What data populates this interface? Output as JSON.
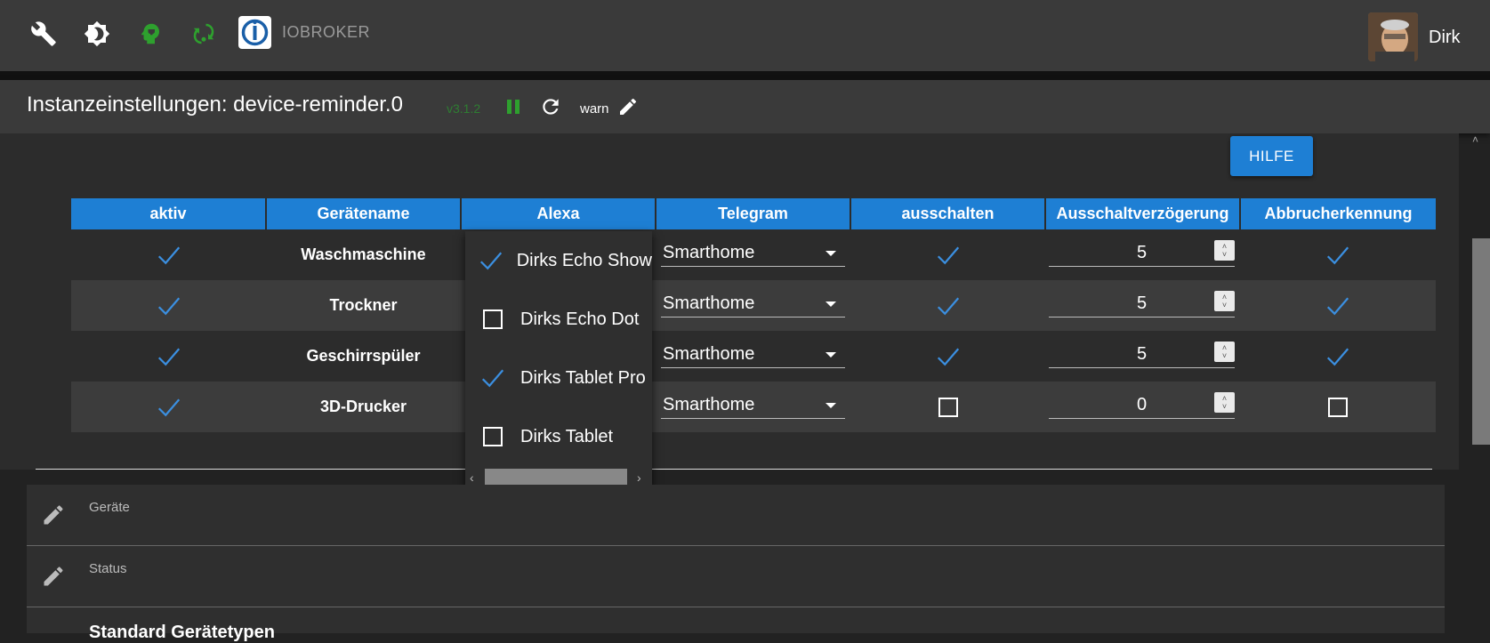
{
  "topbar": {
    "brand": "IOBROKER",
    "user": "Dirk",
    "icons": [
      "wrench-icon",
      "theme-icon",
      "expert-mode-icon",
      "update-icon"
    ]
  },
  "header": {
    "title": "Instanzeinstellungen: device-reminder.0",
    "version": "v3.1.2",
    "log_level": "warn"
  },
  "help_button": "HILFE",
  "table": {
    "columns": [
      "aktiv",
      "Gerätename",
      "Alexa",
      "Telegram",
      "ausschalten",
      "Ausschaltverzögerung",
      "Abbrucherkennung"
    ],
    "rows": [
      {
        "aktiv": true,
        "name": "Waschmaschine",
        "telegram": "Smarthome",
        "ausschalten": true,
        "delay": "5",
        "abbruch": true
      },
      {
        "aktiv": true,
        "name": "Trockner",
        "telegram": "Smarthome",
        "ausschalten": true,
        "delay": "5",
        "abbruch": true
      },
      {
        "aktiv": true,
        "name": "Geschirrspüler",
        "telegram": "Smarthome",
        "ausschalten": true,
        "delay": "5",
        "abbruch": true
      },
      {
        "aktiv": true,
        "name": "3D-Drucker",
        "telegram": "Smarthome",
        "ausschalten": false,
        "delay": "0",
        "abbruch": false
      }
    ]
  },
  "alexa_dropdown": {
    "items": [
      {
        "label": "Dirks Echo Show",
        "checked": true
      },
      {
        "label": "Dirks Echo Dot",
        "checked": false
      },
      {
        "label": "Dirks Tablet Pro",
        "checked": true
      },
      {
        "label": "Dirks Tablet",
        "checked": false
      }
    ]
  },
  "panels": {
    "geraete": "Geräte",
    "status": "Status",
    "standard": "Standard Gerätetypen"
  },
  "colors": {
    "accent": "#1e7fd4",
    "check": "#3b8fe0",
    "green": "#2ea02e"
  }
}
